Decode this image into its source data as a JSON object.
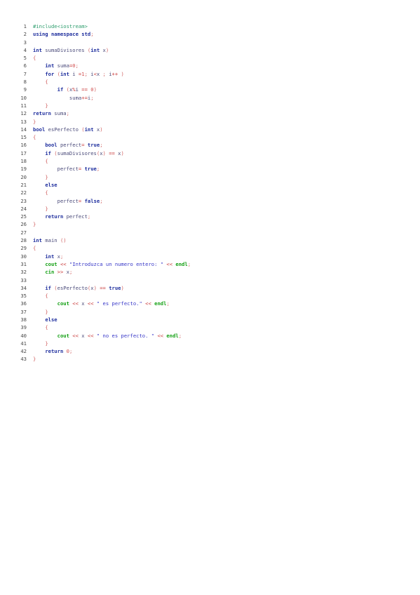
{
  "code": {
    "language": "C++",
    "lines": [
      {
        "n": "1",
        "tokens": [
          {
            "t": "#include<iostream>",
            "c": "pp"
          }
        ]
      },
      {
        "n": "2",
        "tokens": [
          {
            "t": "using",
            "c": "kw"
          },
          {
            "t": " ",
            "c": "id"
          },
          {
            "t": "namespace",
            "c": "kw"
          },
          {
            "t": " ",
            "c": "id"
          },
          {
            "t": "std",
            "c": "kw"
          },
          {
            "t": ";",
            "c": "pun"
          }
        ]
      },
      {
        "n": "3",
        "tokens": []
      },
      {
        "n": "4",
        "tokens": [
          {
            "t": "int",
            "c": "kw"
          },
          {
            "t": " sumaDivisores ",
            "c": "id"
          },
          {
            "t": "(",
            "c": "pun"
          },
          {
            "t": "int",
            "c": "kw"
          },
          {
            "t": " x",
            "c": "id"
          },
          {
            "t": ")",
            "c": "pun"
          }
        ]
      },
      {
        "n": "5",
        "tokens": [
          {
            "t": "{",
            "c": "pun"
          }
        ]
      },
      {
        "n": "6",
        "tokens": [
          {
            "t": "    ",
            "c": "id"
          },
          {
            "t": "int",
            "c": "kw"
          },
          {
            "t": " suma",
            "c": "id"
          },
          {
            "t": "=",
            "c": "op"
          },
          {
            "t": "0",
            "c": "num"
          },
          {
            "t": ";",
            "c": "pun"
          }
        ]
      },
      {
        "n": "7",
        "tokens": [
          {
            "t": "    ",
            "c": "id"
          },
          {
            "t": "for",
            "c": "kw"
          },
          {
            "t": " ",
            "c": "id"
          },
          {
            "t": "(",
            "c": "pun"
          },
          {
            "t": "int",
            "c": "kw"
          },
          {
            "t": " i ",
            "c": "id"
          },
          {
            "t": "=",
            "c": "op"
          },
          {
            "t": "1",
            "c": "num"
          },
          {
            "t": "; ",
            "c": "pun"
          },
          {
            "t": "i",
            "c": "id"
          },
          {
            "t": "<",
            "c": "op"
          },
          {
            "t": "x ",
            "c": "id"
          },
          {
            "t": "; ",
            "c": "pun"
          },
          {
            "t": "i",
            "c": "id"
          },
          {
            "t": "++",
            "c": "op"
          },
          {
            "t": " )",
            "c": "pun"
          }
        ]
      },
      {
        "n": "8",
        "tokens": [
          {
            "t": "    ",
            "c": "id"
          },
          {
            "t": "{",
            "c": "pun"
          }
        ]
      },
      {
        "n": "9",
        "tokens": [
          {
            "t": "        ",
            "c": "id"
          },
          {
            "t": "if",
            "c": "kw"
          },
          {
            "t": " ",
            "c": "id"
          },
          {
            "t": "(",
            "c": "pun"
          },
          {
            "t": "x",
            "c": "id"
          },
          {
            "t": "%",
            "c": "op"
          },
          {
            "t": "i ",
            "c": "id"
          },
          {
            "t": "==",
            "c": "op"
          },
          {
            "t": " ",
            "c": "id"
          },
          {
            "t": "0",
            "c": "num"
          },
          {
            "t": ")",
            "c": "pun"
          }
        ]
      },
      {
        "n": "10",
        "tokens": [
          {
            "t": "            suma",
            "c": "id"
          },
          {
            "t": "+=",
            "c": "op"
          },
          {
            "t": "i",
            "c": "id"
          },
          {
            "t": ";",
            "c": "pun"
          }
        ]
      },
      {
        "n": "11",
        "tokens": [
          {
            "t": "    ",
            "c": "id"
          },
          {
            "t": "}",
            "c": "pun"
          }
        ]
      },
      {
        "n": "12",
        "tokens": [
          {
            "t": "return",
            "c": "kw"
          },
          {
            "t": " suma",
            "c": "id"
          },
          {
            "t": ";",
            "c": "pun"
          }
        ]
      },
      {
        "n": "13",
        "tokens": [
          {
            "t": "}",
            "c": "pun"
          }
        ]
      },
      {
        "n": "14",
        "tokens": [
          {
            "t": "bool",
            "c": "kw"
          },
          {
            "t": " esPerfecto ",
            "c": "id"
          },
          {
            "t": "(",
            "c": "pun"
          },
          {
            "t": "int",
            "c": "kw"
          },
          {
            "t": " x",
            "c": "id"
          },
          {
            "t": ")",
            "c": "pun"
          }
        ]
      },
      {
        "n": "15",
        "tokens": [
          {
            "t": "{",
            "c": "pun"
          }
        ]
      },
      {
        "n": "16",
        "tokens": [
          {
            "t": "    ",
            "c": "id"
          },
          {
            "t": "bool",
            "c": "kw"
          },
          {
            "t": " perfect",
            "c": "id"
          },
          {
            "t": "=",
            "c": "op"
          },
          {
            "t": " ",
            "c": "id"
          },
          {
            "t": "true",
            "c": "kw"
          },
          {
            "t": ";",
            "c": "pun"
          }
        ]
      },
      {
        "n": "17",
        "tokens": [
          {
            "t": "    ",
            "c": "id"
          },
          {
            "t": "if",
            "c": "kw"
          },
          {
            "t": " ",
            "c": "id"
          },
          {
            "t": "(",
            "c": "pun"
          },
          {
            "t": "sumaDivisores",
            "c": "id"
          },
          {
            "t": "(",
            "c": "pun"
          },
          {
            "t": "x",
            "c": "id"
          },
          {
            "t": ")",
            "c": "pun"
          },
          {
            "t": " ",
            "c": "id"
          },
          {
            "t": "==",
            "c": "op"
          },
          {
            "t": " x",
            "c": "id"
          },
          {
            "t": ")",
            "c": "pun"
          }
        ]
      },
      {
        "n": "18",
        "tokens": [
          {
            "t": "    ",
            "c": "id"
          },
          {
            "t": "{",
            "c": "pun"
          }
        ]
      },
      {
        "n": "19",
        "tokens": [
          {
            "t": "        perfect",
            "c": "id"
          },
          {
            "t": "=",
            "c": "op"
          },
          {
            "t": " ",
            "c": "id"
          },
          {
            "t": "true",
            "c": "kw"
          },
          {
            "t": ";",
            "c": "pun"
          }
        ]
      },
      {
        "n": "20",
        "tokens": [
          {
            "t": "    ",
            "c": "id"
          },
          {
            "t": "}",
            "c": "pun"
          }
        ]
      },
      {
        "n": "21",
        "tokens": [
          {
            "t": "    ",
            "c": "id"
          },
          {
            "t": "else",
            "c": "kw"
          }
        ]
      },
      {
        "n": "22",
        "tokens": [
          {
            "t": "    ",
            "c": "id"
          },
          {
            "t": "{",
            "c": "pun"
          }
        ]
      },
      {
        "n": "23",
        "tokens": [
          {
            "t": "        perfect",
            "c": "id"
          },
          {
            "t": "=",
            "c": "op"
          },
          {
            "t": " ",
            "c": "id"
          },
          {
            "t": "false",
            "c": "kw"
          },
          {
            "t": ";",
            "c": "pun"
          }
        ]
      },
      {
        "n": "24",
        "tokens": [
          {
            "t": "    ",
            "c": "id"
          },
          {
            "t": "}",
            "c": "pun"
          }
        ]
      },
      {
        "n": "25",
        "tokens": [
          {
            "t": "    ",
            "c": "id"
          },
          {
            "t": "return",
            "c": "kw"
          },
          {
            "t": " perfect",
            "c": "id"
          },
          {
            "t": ";",
            "c": "pun"
          }
        ]
      },
      {
        "n": "26",
        "tokens": [
          {
            "t": "}",
            "c": "pun"
          }
        ]
      },
      {
        "n": "27",
        "tokens": []
      },
      {
        "n": "28",
        "tokens": [
          {
            "t": "int",
            "c": "kw"
          },
          {
            "t": " main ",
            "c": "id"
          },
          {
            "t": "()",
            "c": "pun"
          }
        ]
      },
      {
        "n": "29",
        "tokens": [
          {
            "t": "{",
            "c": "pun"
          }
        ]
      },
      {
        "n": "30",
        "tokens": [
          {
            "t": "    ",
            "c": "id"
          },
          {
            "t": "int",
            "c": "kw"
          },
          {
            "t": " x",
            "c": "id"
          },
          {
            "t": ";",
            "c": "pun"
          }
        ]
      },
      {
        "n": "31",
        "tokens": [
          {
            "t": "    ",
            "c": "id"
          },
          {
            "t": "cout",
            "c": "grn"
          },
          {
            "t": " ",
            "c": "id"
          },
          {
            "t": "<<",
            "c": "op"
          },
          {
            "t": " ",
            "c": "id"
          },
          {
            "t": "\"Introduzca un numero entero: \"",
            "c": "str"
          },
          {
            "t": " ",
            "c": "id"
          },
          {
            "t": "<<",
            "c": "op"
          },
          {
            "t": " ",
            "c": "id"
          },
          {
            "t": "endl",
            "c": "grn"
          },
          {
            "t": ";",
            "c": "pun"
          }
        ]
      },
      {
        "n": "32",
        "tokens": [
          {
            "t": "    ",
            "c": "id"
          },
          {
            "t": "cin",
            "c": "grn"
          },
          {
            "t": " ",
            "c": "id"
          },
          {
            "t": ">>",
            "c": "op"
          },
          {
            "t": " x",
            "c": "id"
          },
          {
            "t": ";",
            "c": "pun"
          }
        ]
      },
      {
        "n": "33",
        "tokens": []
      },
      {
        "n": "34",
        "tokens": [
          {
            "t": "    ",
            "c": "id"
          },
          {
            "t": "if",
            "c": "kw"
          },
          {
            "t": " ",
            "c": "id"
          },
          {
            "t": "(",
            "c": "pun"
          },
          {
            "t": "esPerfecto",
            "c": "id"
          },
          {
            "t": "(",
            "c": "pun"
          },
          {
            "t": "x",
            "c": "id"
          },
          {
            "t": ")",
            "c": "pun"
          },
          {
            "t": " ",
            "c": "id"
          },
          {
            "t": "==",
            "c": "op"
          },
          {
            "t": " ",
            "c": "id"
          },
          {
            "t": "true",
            "c": "kw"
          },
          {
            "t": ")",
            "c": "pun"
          }
        ]
      },
      {
        "n": "35",
        "tokens": [
          {
            "t": "    ",
            "c": "id"
          },
          {
            "t": "{",
            "c": "pun"
          }
        ]
      },
      {
        "n": "36",
        "tokens": [
          {
            "t": "        ",
            "c": "id"
          },
          {
            "t": "cout",
            "c": "grn"
          },
          {
            "t": " ",
            "c": "id"
          },
          {
            "t": "<<",
            "c": "op"
          },
          {
            "t": " x ",
            "c": "id"
          },
          {
            "t": "<<",
            "c": "op"
          },
          {
            "t": " ",
            "c": "id"
          },
          {
            "t": "\" es perfecto.\"",
            "c": "str"
          },
          {
            "t": " ",
            "c": "id"
          },
          {
            "t": "<<",
            "c": "op"
          },
          {
            "t": " ",
            "c": "id"
          },
          {
            "t": "endl",
            "c": "grn"
          },
          {
            "t": ";",
            "c": "pun"
          }
        ]
      },
      {
        "n": "37",
        "tokens": [
          {
            "t": "    ",
            "c": "id"
          },
          {
            "t": "}",
            "c": "pun"
          }
        ]
      },
      {
        "n": "38",
        "tokens": [
          {
            "t": "    ",
            "c": "id"
          },
          {
            "t": "else",
            "c": "kw"
          }
        ]
      },
      {
        "n": "39",
        "tokens": [
          {
            "t": "    ",
            "c": "id"
          },
          {
            "t": "{",
            "c": "pun"
          }
        ]
      },
      {
        "n": "40",
        "tokens": [
          {
            "t": "        ",
            "c": "id"
          },
          {
            "t": "cout",
            "c": "grn"
          },
          {
            "t": " ",
            "c": "id"
          },
          {
            "t": "<<",
            "c": "op"
          },
          {
            "t": " x ",
            "c": "id"
          },
          {
            "t": "<<",
            "c": "op"
          },
          {
            "t": " ",
            "c": "id"
          },
          {
            "t": "\" no es perfecto. \"",
            "c": "str"
          },
          {
            "t": " ",
            "c": "id"
          },
          {
            "t": "<<",
            "c": "op"
          },
          {
            "t": " ",
            "c": "id"
          },
          {
            "t": "endl",
            "c": "grn"
          },
          {
            "t": ";",
            "c": "pun"
          }
        ]
      },
      {
        "n": "41",
        "tokens": [
          {
            "t": "    ",
            "c": "id"
          },
          {
            "t": "}",
            "c": "pun"
          }
        ]
      },
      {
        "n": "42",
        "tokens": [
          {
            "t": "    ",
            "c": "id"
          },
          {
            "t": "return",
            "c": "kw"
          },
          {
            "t": " ",
            "c": "id"
          },
          {
            "t": "0",
            "c": "num"
          },
          {
            "t": ";",
            "c": "pun"
          }
        ]
      },
      {
        "n": "43",
        "tokens": [
          {
            "t": "}",
            "c": "pun"
          }
        ]
      }
    ]
  },
  "colors": {
    "keyword": "#1f2f9e",
    "identifier": "#4b4b7a",
    "operator": "#c83737",
    "number": "#d25252",
    "punctuation": "#d06060",
    "string": "#3838c8",
    "stream": "#14a014",
    "preprocessor": "#2e9e6e",
    "line_number": "#4a4a4a"
  }
}
